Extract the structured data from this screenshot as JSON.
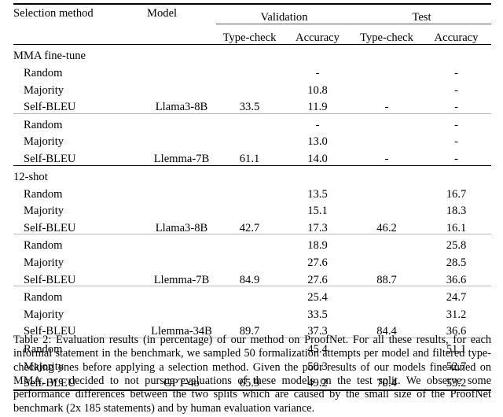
{
  "table": {
    "columns": {
      "selection_method": "Selection method",
      "model": "Model",
      "group_validation": "Validation",
      "group_test": "Test",
      "val_typecheck": "Type-check",
      "val_accuracy": "Accuracy",
      "test_typecheck": "Type-check",
      "test_accuracy": "Accuracy"
    },
    "sections": [
      {
        "title": "MMA fine-tune",
        "blocks": [
          {
            "model": "Llama3-8B",
            "val_typecheck": "33.5",
            "test_typecheck": "-",
            "rows": [
              {
                "method": "Random",
                "val_accuracy": "-",
                "test_accuracy": "-"
              },
              {
                "method": "Majority",
                "val_accuracy": "10.8",
                "test_accuracy": "-"
              },
              {
                "method": "Self-BLEU",
                "val_accuracy": "11.9",
                "test_accuracy": "-"
              }
            ]
          },
          {
            "model": "Llemma-7B",
            "val_typecheck": "61.1",
            "test_typecheck": "-",
            "rows": [
              {
                "method": "Random",
                "val_accuracy": "-",
                "test_accuracy": "-"
              },
              {
                "method": "Majority",
                "val_accuracy": "13.0",
                "test_accuracy": "-"
              },
              {
                "method": "Self-BLEU",
                "val_accuracy": "14.0",
                "test_accuracy": "-"
              }
            ]
          }
        ]
      },
      {
        "title": "12-shot",
        "blocks": [
          {
            "model": "Llama3-8B",
            "val_typecheck": "42.7",
            "test_typecheck": "46.2",
            "rows": [
              {
                "method": "Random",
                "val_accuracy": "13.5",
                "test_accuracy": "16.7"
              },
              {
                "method": "Majority",
                "val_accuracy": "15.1",
                "test_accuracy": "18.3"
              },
              {
                "method": "Self-BLEU",
                "val_accuracy": "17.3",
                "test_accuracy": "16.1"
              }
            ]
          },
          {
            "model": "Llemma-7B",
            "val_typecheck": "84.9",
            "test_typecheck": "88.7",
            "rows": [
              {
                "method": "Random",
                "val_accuracy": "18.9",
                "test_accuracy": "25.8"
              },
              {
                "method": "Majority",
                "val_accuracy": "27.6",
                "test_accuracy": "28.5"
              },
              {
                "method": "Self-BLEU",
                "val_accuracy": "27.6",
                "test_accuracy": "36.6"
              }
            ]
          },
          {
            "model": "Llemma-34B",
            "val_typecheck": "89.7",
            "test_typecheck": "84.4",
            "rows": [
              {
                "method": "Random",
                "val_accuracy": "25.4",
                "test_accuracy": "24.7"
              },
              {
                "method": "Majority",
                "val_accuracy": "33.5",
                "test_accuracy": "31.2"
              },
              {
                "method": "Self-BLEU",
                "val_accuracy": "37.3",
                "test_accuracy": "36.6"
              }
            ]
          },
          {
            "model": "GPT-4o",
            "val_typecheck": "65.9",
            "test_typecheck": "70.4",
            "rows": [
              {
                "method": "Random",
                "val_accuracy": "45.4",
                "test_accuracy": "51.1"
              },
              {
                "method": "Majority",
                "val_accuracy": "50.3",
                "test_accuracy": "52.7"
              },
              {
                "method": "Self-BLEU",
                "val_accuracy": "49.2",
                "test_accuracy": "53.2"
              }
            ]
          }
        ]
      }
    ]
  },
  "caption": {
    "text": "Table 2: Evaluation results (in percentage) of our method on ProofNet. For all these results, for each informal statement in the benchmark, we sampled 50 formalization attempts per model and filtered type-checking ones before applying a selection method. Given the poor results of our models fine-tuned on MMA, we decided to not pursue evaluations of these models on the test split. We observe some performance differences between the two splits which are caused by the small size of the ProofNet benchmark (2x 185 statements) and by human evaluation variance."
  }
}
